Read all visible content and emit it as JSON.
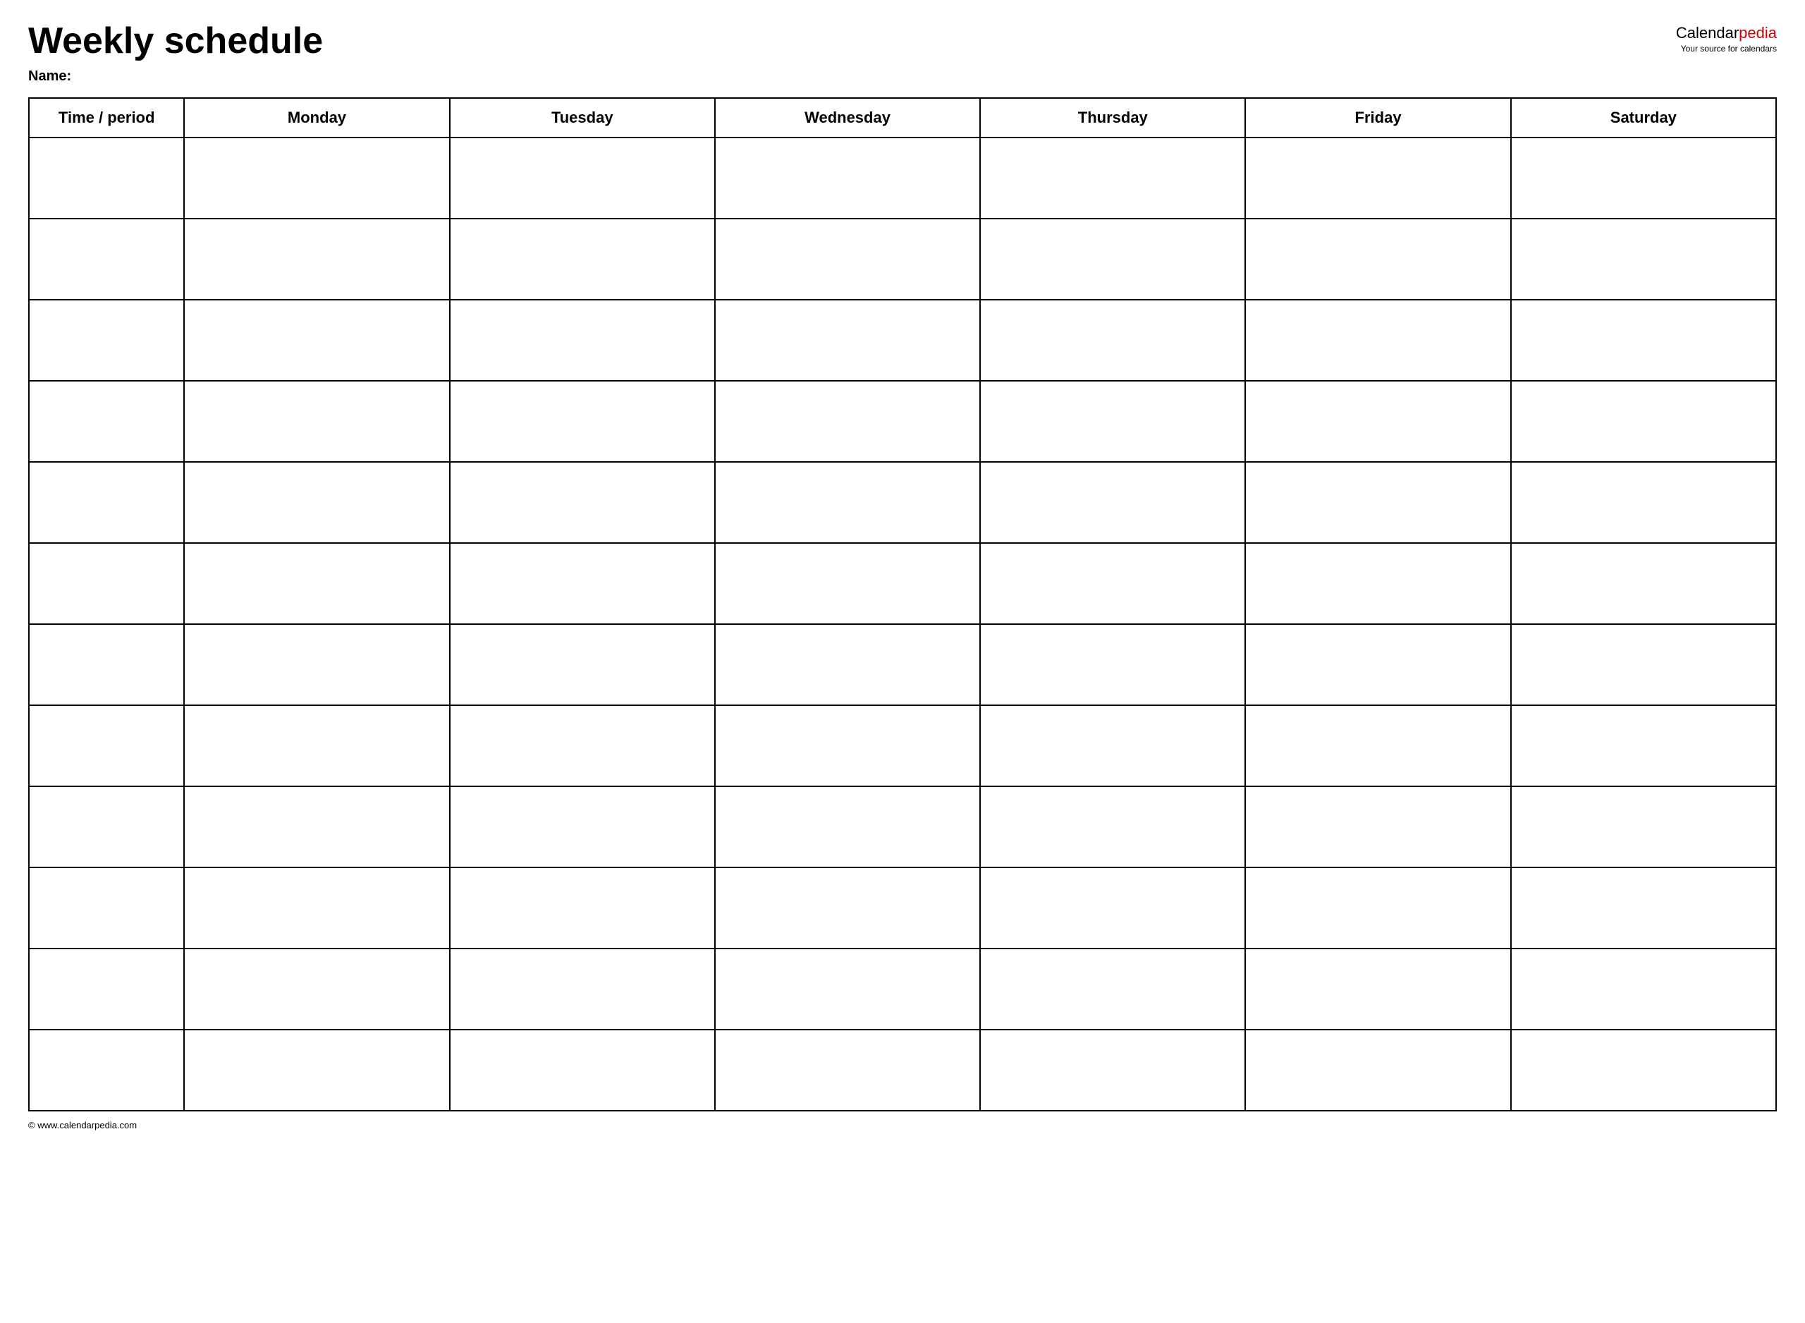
{
  "header": {
    "title": "Weekly schedule",
    "name_label": "Name:"
  },
  "logo": {
    "part1": "Calendar",
    "part2": "pedia",
    "tagline": "Your source for calendars"
  },
  "table": {
    "columns": [
      {
        "key": "time",
        "label": "Time / period"
      },
      {
        "key": "monday",
        "label": "Monday"
      },
      {
        "key": "tuesday",
        "label": "Tuesday"
      },
      {
        "key": "wednesday",
        "label": "Wednesday"
      },
      {
        "key": "thursday",
        "label": "Thursday"
      },
      {
        "key": "friday",
        "label": "Friday"
      },
      {
        "key": "saturday",
        "label": "Saturday"
      }
    ],
    "row_count": 12
  },
  "footer": {
    "url": "© www.calendarpedia.com"
  }
}
